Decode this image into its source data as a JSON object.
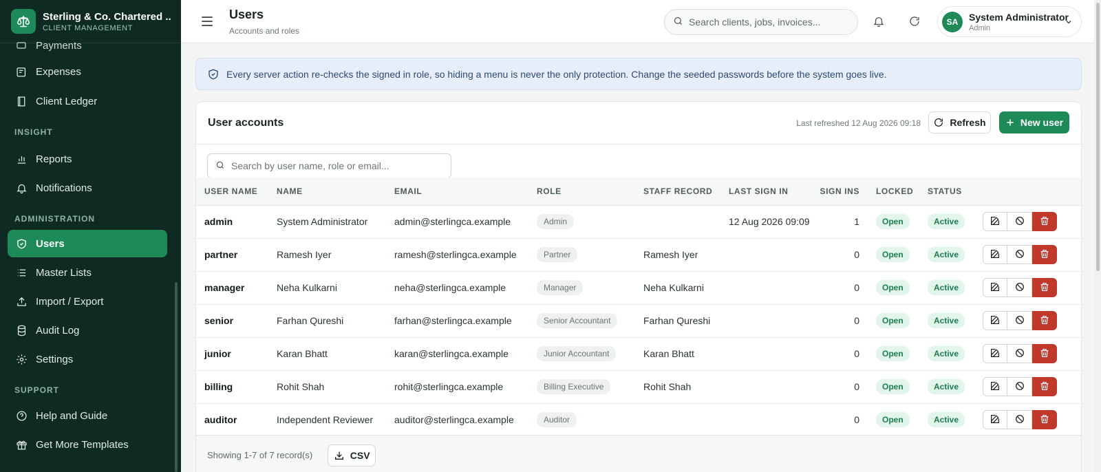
{
  "brand": {
    "title": "Sterling & Co. Chartered ...",
    "subtitle": "CLIENT MANAGEMENT",
    "icon": "scales-icon"
  },
  "sidebar": {
    "partial_item": "Payments",
    "items_top": [
      {
        "label": "Expenses",
        "icon": "wallet-icon"
      },
      {
        "label": "Client Ledger",
        "icon": "book-icon"
      }
    ],
    "sections": [
      {
        "title": "INSIGHT",
        "items": [
          {
            "label": "Reports",
            "icon": "chart-icon"
          },
          {
            "label": "Notifications",
            "icon": "bell-icon"
          }
        ]
      },
      {
        "title": "ADMINISTRATION",
        "items": [
          {
            "label": "Users",
            "icon": "shield-icon",
            "active": true
          },
          {
            "label": "Master Lists",
            "icon": "list-icon"
          },
          {
            "label": "Import / Export",
            "icon": "upload-icon"
          },
          {
            "label": "Audit Log",
            "icon": "database-icon"
          },
          {
            "label": "Settings",
            "icon": "gear-icon"
          }
        ]
      },
      {
        "title": "SUPPORT",
        "items": [
          {
            "label": "Help and Guide",
            "icon": "help-icon"
          },
          {
            "label": "Get More Templates",
            "icon": "gift-icon"
          }
        ]
      }
    ]
  },
  "header": {
    "title": "Users",
    "subtitle": "Accounts and roles",
    "search_placeholder": "Search clients, jobs, invoices...",
    "user": {
      "initials": "SA",
      "name": "System Administrator",
      "role": "Admin"
    }
  },
  "banner": {
    "text": "Every server action re-checks the signed in role, so hiding a menu is never the only protection. Change the seeded passwords before the system goes live."
  },
  "card": {
    "title": "User accounts",
    "refreshed": "Last refreshed 12 Aug 2026 09:18",
    "refresh_label": "Refresh",
    "new_label": "New user",
    "search_placeholder": "Search by user name, role or email...",
    "columns": [
      "User Name",
      "Name",
      "Email",
      "Role",
      "Staff Record",
      "Last Sign In",
      "Sign Ins",
      "Locked",
      "Status"
    ],
    "rows": [
      {
        "username": "admin",
        "name": "System Administrator",
        "email": "admin@sterlingca.example",
        "role": "Admin",
        "staff": "",
        "last": "12 Aug 2026 09:09",
        "signins": "1",
        "locked": "Open",
        "status": "Active"
      },
      {
        "username": "partner",
        "name": "Ramesh Iyer",
        "email": "ramesh@sterlingca.example",
        "role": "Partner",
        "staff": "Ramesh Iyer",
        "last": "",
        "signins": "0",
        "locked": "Open",
        "status": "Active"
      },
      {
        "username": "manager",
        "name": "Neha Kulkarni",
        "email": "neha@sterlingca.example",
        "role": "Manager",
        "staff": "Neha Kulkarni",
        "last": "",
        "signins": "0",
        "locked": "Open",
        "status": "Active"
      },
      {
        "username": "senior",
        "name": "Farhan Qureshi",
        "email": "farhan@sterlingca.example",
        "role": "Senior Accountant",
        "staff": "Farhan Qureshi",
        "last": "",
        "signins": "0",
        "locked": "Open",
        "status": "Active"
      },
      {
        "username": "junior",
        "name": "Karan Bhatt",
        "email": "karan@sterlingca.example",
        "role": "Junior Accountant",
        "staff": "Karan Bhatt",
        "last": "",
        "signins": "0",
        "locked": "Open",
        "status": "Active"
      },
      {
        "username": "billing",
        "name": "Rohit Shah",
        "email": "rohit@sterlingca.example",
        "role": "Billing Executive",
        "staff": "Rohit Shah",
        "last": "",
        "signins": "0",
        "locked": "Open",
        "status": "Active"
      },
      {
        "username": "auditor",
        "name": "Independent Reviewer",
        "email": "auditor@sterlingca.example",
        "role": "Auditor",
        "staff": "",
        "last": "",
        "signins": "0",
        "locked": "Open",
        "status": "Active"
      }
    ],
    "footer": {
      "showing": "Showing 1-7 of 7 record(s)",
      "csv_label": "CSV"
    }
  },
  "colors": {
    "accent": "#1d8a58",
    "sidebar": "#0f2a22",
    "danger": "#c0392b",
    "banner": "#e7eef9"
  }
}
